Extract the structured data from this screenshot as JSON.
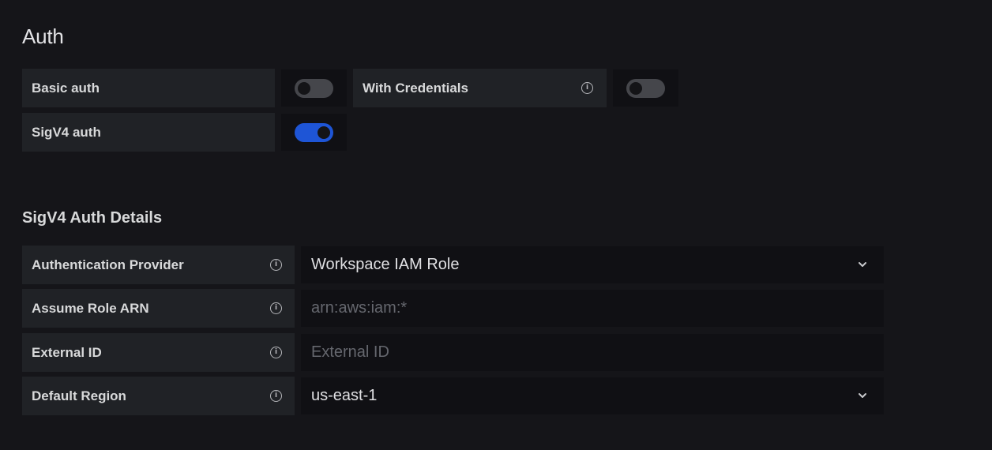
{
  "auth": {
    "title": "Auth",
    "basic_auth_label": "Basic auth",
    "with_credentials_label": "With Credentials",
    "sigv4_auth_label": "SigV4 auth",
    "basic_auth_enabled": false,
    "with_credentials_enabled": false,
    "sigv4_auth_enabled": true
  },
  "sigv4": {
    "title": "SigV4 Auth Details",
    "authentication_provider_label": "Authentication Provider",
    "authentication_provider_value": "Workspace IAM Role",
    "assume_role_arn_label": "Assume Role ARN",
    "assume_role_arn_placeholder": "arn:aws:iam:*",
    "external_id_label": "External ID",
    "external_id_placeholder": "External ID",
    "default_region_label": "Default Region",
    "default_region_value": "us-east-1"
  },
  "colors": {
    "background": "#151519",
    "label_bg": "#202226",
    "input_bg": "#101014",
    "toggle_on": "#1e55d6",
    "toggle_off": "#45464b"
  },
  "icons": {
    "info": "info-circle-icon",
    "dropdown": "chevron-down-icon"
  }
}
